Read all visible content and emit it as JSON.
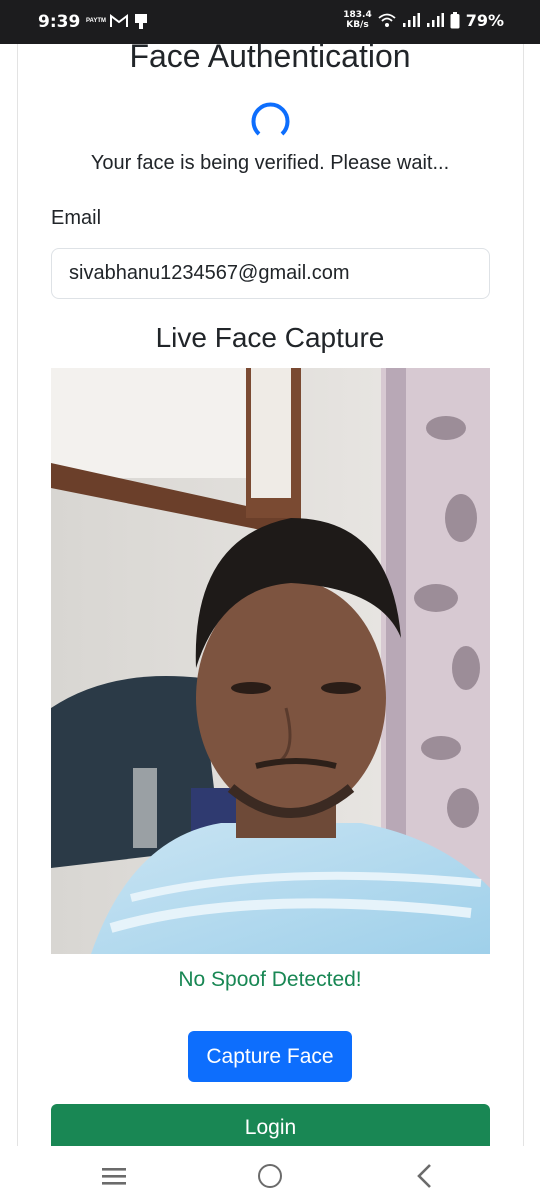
{
  "status_bar": {
    "time": "9:39",
    "paytm_label": "PAYTM",
    "net_speed_value": "183.4",
    "net_speed_unit": "KB/s",
    "battery": "79%",
    "icons": [
      "paytm-icon",
      "gmail-icon",
      "sim-icon",
      "wifi-icon",
      "signal-icon",
      "signal-icon",
      "battery-icon"
    ]
  },
  "page": {
    "title": "Face Authentication",
    "verify_message": "Your face is being verified. Please wait...",
    "email_label": "Email",
    "email_value": "sivabhanu1234567@gmail.com",
    "capture_heading": "Live Face Capture",
    "spoof_message": "No Spoof Detected!",
    "capture_button": "Capture Face",
    "login_button": "Login"
  },
  "colors": {
    "primary": "#0d6efd",
    "success": "#198754",
    "text": "#212529",
    "status_bar": "#1c1c1e"
  },
  "nav_bar": {
    "icons": [
      "recents-icon",
      "home-icon",
      "back-icon"
    ]
  }
}
